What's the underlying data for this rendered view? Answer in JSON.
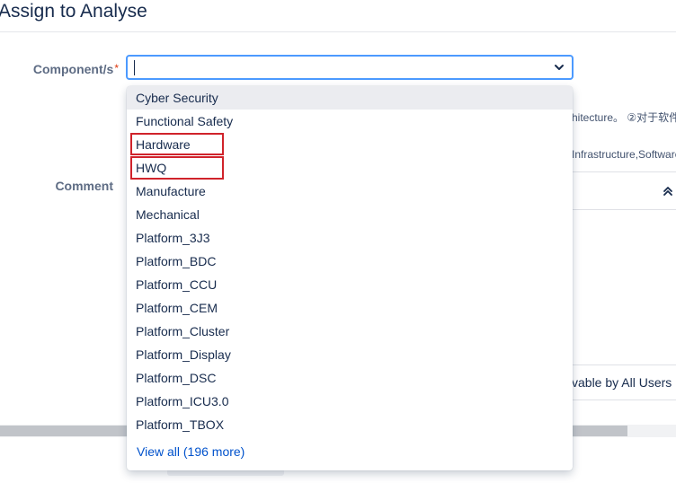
{
  "dialog": {
    "title": "Assign to Analyse"
  },
  "form": {
    "component_label": "Component/s",
    "required_marker": "*",
    "comment_label": "Comment"
  },
  "component_select": {
    "value": "",
    "dropdown_icon": "chevron-down-icon"
  },
  "background": {
    "desc_line_1": "hitecture。 ②对于软件",
    "desc_line_2": "Infrastructure,Software",
    "editor_collapse_icon": "double-chevron-up-icon",
    "visibility_label": "vable by All Users"
  },
  "dropdown": {
    "items": [
      {
        "label": "Cyber Security"
      },
      {
        "label": "Functional Safety"
      },
      {
        "label": "Hardware"
      },
      {
        "label": "HWQ"
      },
      {
        "label": "Manufacture"
      },
      {
        "label": "Mechanical"
      },
      {
        "label": "Platform_3J3"
      },
      {
        "label": "Platform_BDC"
      },
      {
        "label": "Platform_CCU"
      },
      {
        "label": "Platform_CEM"
      },
      {
        "label": "Platform_Cluster"
      },
      {
        "label": "Platform_Display"
      },
      {
        "label": "Platform_DSC"
      },
      {
        "label": "Platform_ICU3.0"
      },
      {
        "label": "Platform_TBOX"
      }
    ],
    "view_all": "View all (196 more)",
    "highlight_color": "#d0232b"
  },
  "colors": {
    "focus_border": "#4c9aff",
    "link": "#0052cc",
    "required": "#de350b"
  }
}
